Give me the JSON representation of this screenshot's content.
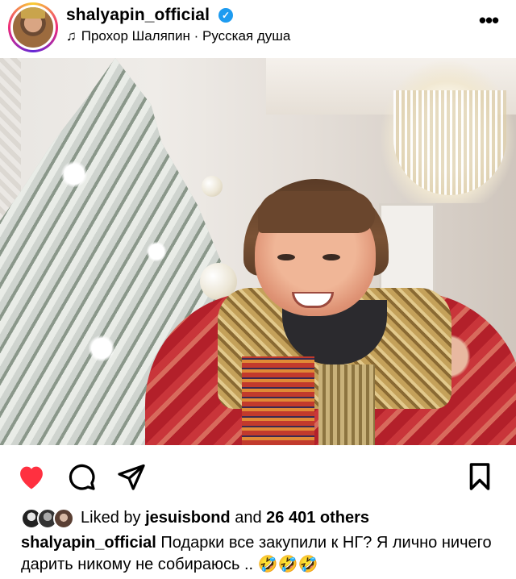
{
  "header": {
    "username": "shalyapin_official",
    "verified": true,
    "music_text": "Прохор Шаляпин · Русская душа",
    "icons": {
      "music": "music-note-icon",
      "more": "more-options-icon",
      "verified": "verified-badge-icon"
    }
  },
  "media": {
    "icons": {
      "mute": "speaker-muted-icon"
    }
  },
  "actions": {
    "liked": true,
    "like_color": "#ff3040",
    "icons": {
      "like": "heart-icon",
      "comment": "comment-icon",
      "share": "share-icon",
      "save": "bookmark-icon"
    }
  },
  "likes": {
    "prefix": "Liked by",
    "user": "jesuisbond",
    "middle": "and",
    "others": "26 401 others"
  },
  "caption": {
    "username": "shalyapin_official",
    "text": "Подарки все закупили к НГ? Я лично ничего дарить никому не собираюсь .. 🤣🤣🤣"
  }
}
